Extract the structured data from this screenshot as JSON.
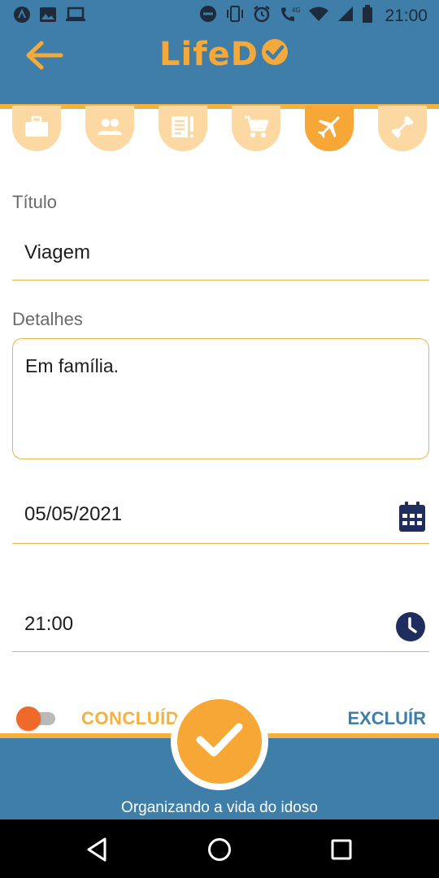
{
  "status_bar": {
    "time": "21:00",
    "icons": [
      "app-icon",
      "image-icon",
      "laptop-icon",
      "do-not-disturb-icon",
      "vibrate-icon",
      "alarm-icon",
      "wifi-calling-icon",
      "wifi-icon",
      "signal-icon",
      "battery-icon"
    ]
  },
  "header": {
    "back_icon": "arrow-left-icon",
    "logo_text": "LifeD"
  },
  "categories": {
    "items": [
      {
        "icon": "briefcase-icon",
        "active": false
      },
      {
        "icon": "people-icon",
        "active": false
      },
      {
        "icon": "notes-icon",
        "active": false
      },
      {
        "icon": "cart-icon",
        "active": false
      },
      {
        "icon": "airplane-icon",
        "active": true
      },
      {
        "icon": "dumbbell-icon",
        "active": false
      }
    ]
  },
  "form": {
    "title_label": "Título",
    "title_value": "Viagem",
    "details_label": "Detalhes",
    "details_value": "Em família.",
    "date_value": "05/05/2021",
    "time_value": "21:00"
  },
  "actions": {
    "done_label": "CONCLUÍDO",
    "delete_label": "EXCLUÍR"
  },
  "footer": {
    "tagline": "Organizando a vida do idoso"
  },
  "colors": {
    "primary_blue": "#3f7ea8",
    "accent_orange": "#f7a735",
    "light_orange": "#fcd8a2",
    "toggle_knob": "#ee6a2a",
    "icon_navy": "#1f2e5e"
  }
}
